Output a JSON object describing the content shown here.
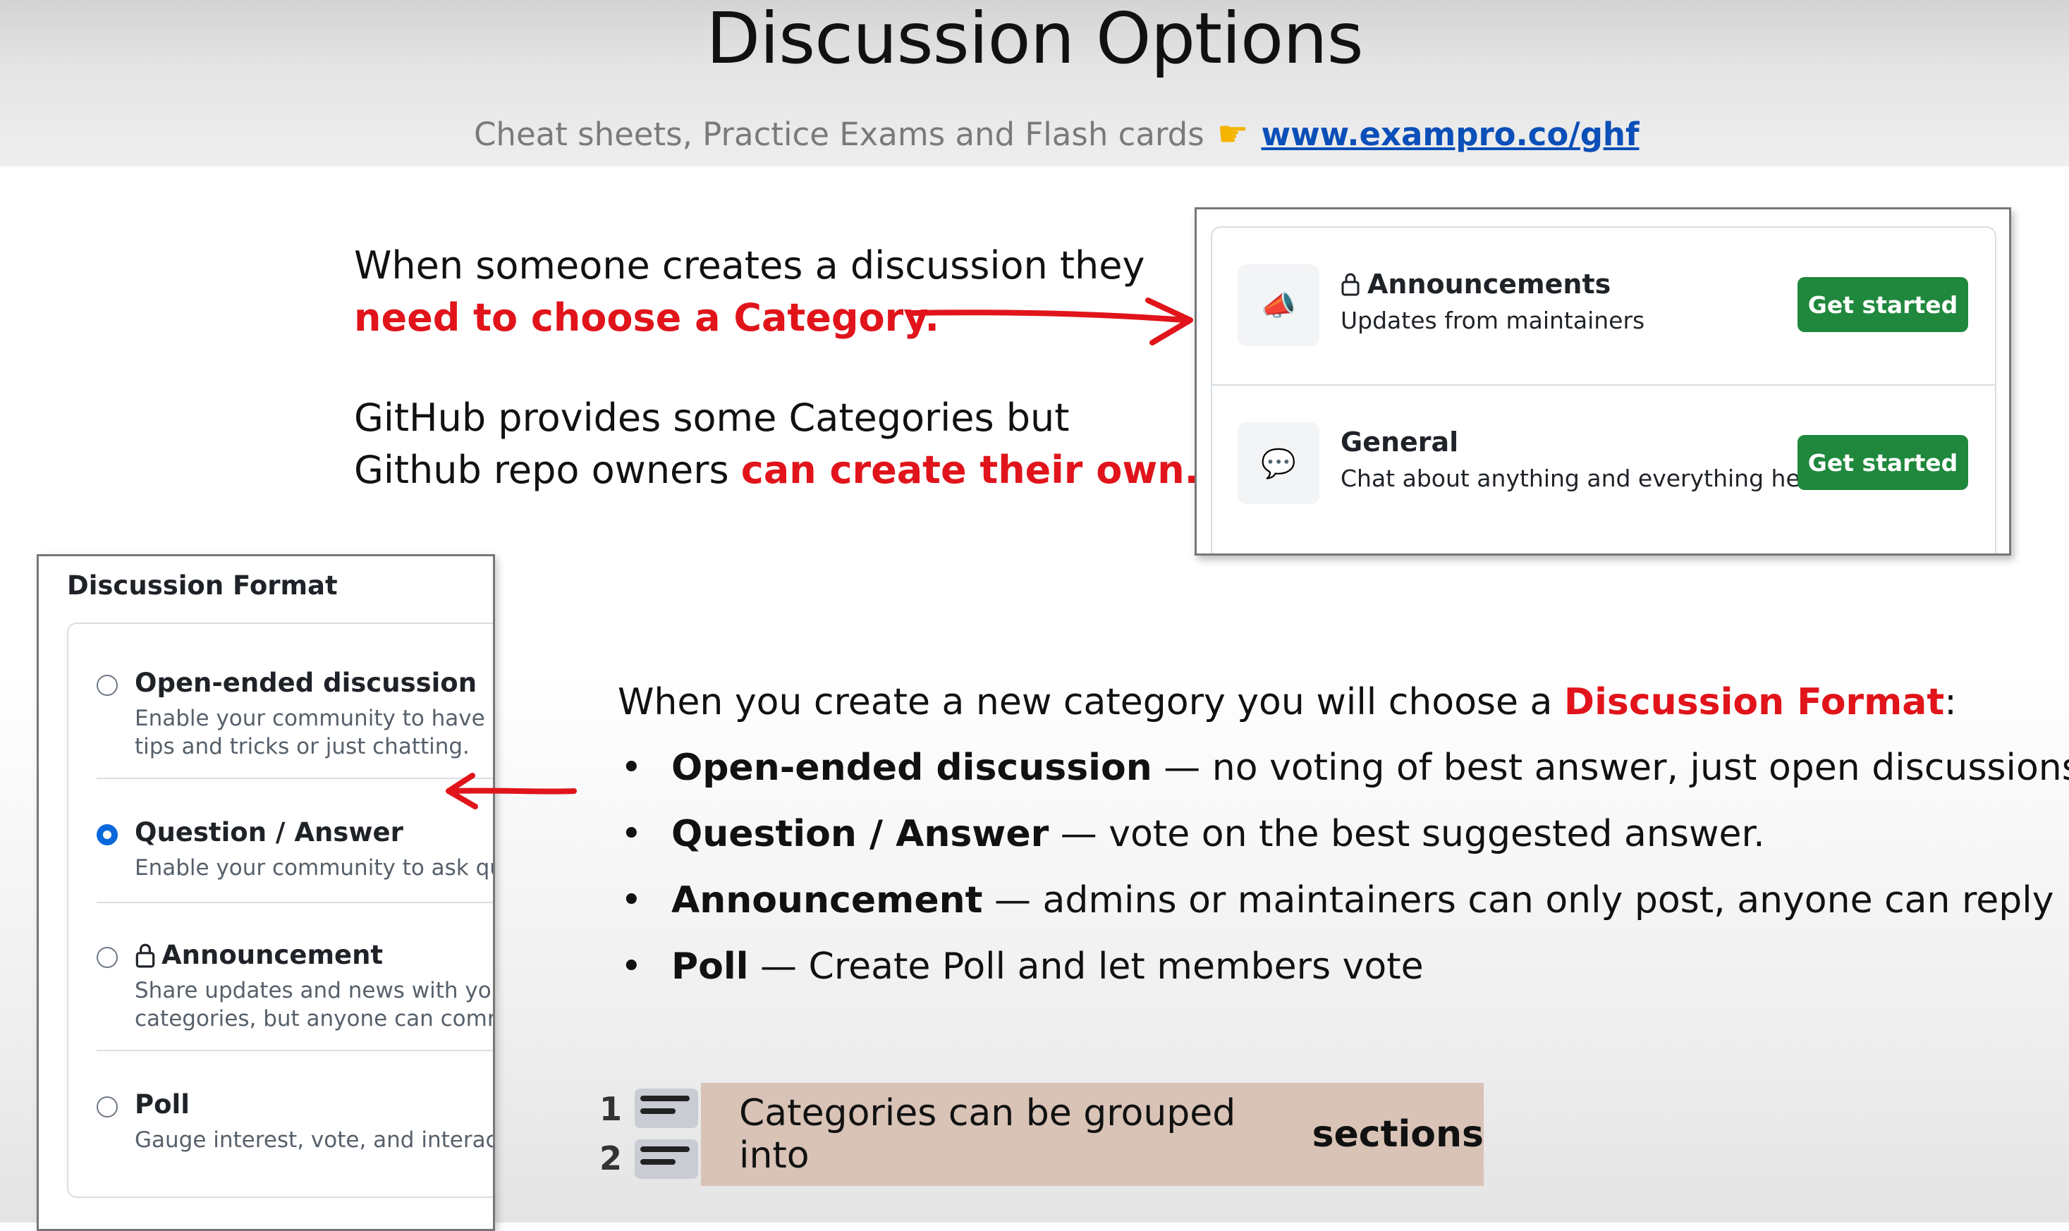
{
  "title": "Discussion Options",
  "subtitle": {
    "text": "Cheat sheets, Practice Exams and Flash cards",
    "icon": "pointing-hand-icon",
    "link": "www.exampro.co/ghf"
  },
  "intro_block": {
    "line1": "When someone creates a discussion they",
    "line2_red": "need to choose a Category.",
    "line3": "GitHub provides some Categories but",
    "line4_prefix": "Github repo owners ",
    "line4_red": "can create their own."
  },
  "categories": [
    {
      "icon": "megaphone-icon",
      "locked": true,
      "name": "Announcements",
      "desc": "Updates from maintainers",
      "button": "Get started"
    },
    {
      "icon": "speech-bubble-icon",
      "locked": false,
      "name": "General",
      "desc": "Chat about anything and everything here",
      "button": "Get started"
    }
  ],
  "format_panel": {
    "title": "Discussion Format",
    "options": [
      {
        "name": "Open-ended discussion",
        "desc1": "Enable your community to have co",
        "desc2": "tips and tricks or just chatting.",
        "selected": false
      },
      {
        "name": "Question / Answer",
        "desc1": "Enable your community to ask que",
        "desc2": "",
        "selected": true
      },
      {
        "name": "Announcement",
        "desc1": "Share updates and news with your",
        "desc2": "categories, but anyone can comm",
        "selected": false
      },
      {
        "name": "Poll",
        "desc1": "Gauge interest, vote, and interact",
        "desc2": "",
        "selected": false
      }
    ]
  },
  "format_intro": {
    "prefix": "When you create a new category you will choose a ",
    "red": "Discussion Format",
    "suffix": ":"
  },
  "bullets": [
    {
      "bold": "Open-ended discussion",
      "rest": " — no voting of best answer, just open discussions"
    },
    {
      "bold": "Question / Answer",
      "rest": " — vote on the best suggested answer."
    },
    {
      "bold": "Announcement",
      "rest": " — admins or maintainers can only post, anyone can reply"
    },
    {
      "bold": "Poll",
      "rest": " — Create Poll and let members vote"
    }
  ],
  "bullet_symbol": "•",
  "sections": {
    "num1": "1",
    "num2": "2",
    "prefix": "Categories can be grouped into ",
    "bold": "sections"
  },
  "colors": {
    "accent_red": "#e0141a",
    "button_green": "#1f883d",
    "radio_blue": "#0969da",
    "link_blue": "#0b4fb8"
  }
}
